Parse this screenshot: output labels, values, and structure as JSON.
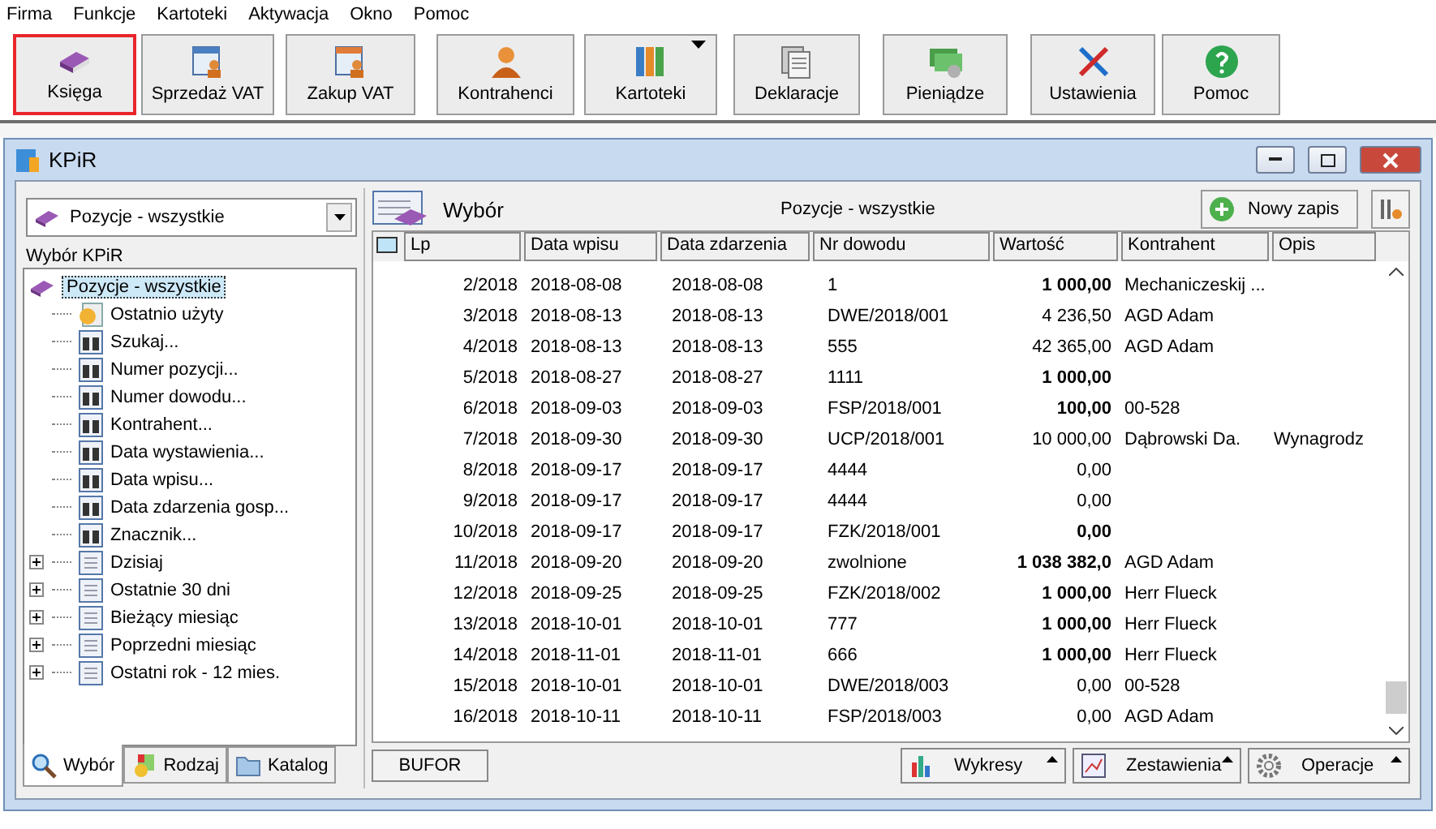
{
  "menu": [
    "Firma",
    "Funkcje",
    "Kartoteki",
    "Aktywacja",
    "Okno",
    "Pomoc"
  ],
  "toolbar": [
    {
      "label": "Księga",
      "kind": "book",
      "selected": true,
      "dropdown": false
    },
    {
      "label": "Sprzedaż VAT",
      "kind": "sale",
      "selected": false,
      "dropdown": false
    },
    {
      "label": "Zakup VAT",
      "kind": "purchase",
      "selected": false,
      "dropdown": false
    },
    {
      "label": "Kontrahenci",
      "kind": "person",
      "selected": false,
      "dropdown": false
    },
    {
      "label": "Kartoteki",
      "kind": "binders",
      "selected": false,
      "dropdown": true
    },
    {
      "label": "Deklaracje",
      "kind": "docs",
      "selected": false,
      "dropdown": false
    },
    {
      "label": "Pieniądze",
      "kind": "money",
      "selected": false,
      "dropdown": false
    },
    {
      "label": "Ustawienia",
      "kind": "tools",
      "selected": false,
      "dropdown": false
    },
    {
      "label": "Pomoc",
      "kind": "help",
      "selected": false,
      "dropdown": false
    }
  ],
  "window": {
    "title": "KPiR"
  },
  "left": {
    "combo": "Pozycje - wszystkie",
    "label": "Wybór KPiR",
    "tree": {
      "label": "Pozycje - wszystkie",
      "selected": true,
      "children": [
        {
          "label": "Ostatnio użyty",
          "kind": "recent",
          "expandable": false
        },
        {
          "label": "Szukaj...",
          "kind": "binoculars",
          "expandable": false
        },
        {
          "label": "Numer pozycji...",
          "kind": "binoculars",
          "expandable": false
        },
        {
          "label": "Numer dowodu...",
          "kind": "binoculars",
          "expandable": false
        },
        {
          "label": "Kontrahent...",
          "kind": "binoculars",
          "expandable": false
        },
        {
          "label": "Data wystawienia...",
          "kind": "binoculars",
          "expandable": false
        },
        {
          "label": "Data wpisu...",
          "kind": "binoculars",
          "expandable": false
        },
        {
          "label": "Data zdarzenia gosp...",
          "kind": "binoculars",
          "expandable": false
        },
        {
          "label": "Znacznik...",
          "kind": "binoculars",
          "expandable": false
        },
        {
          "label": "Dzisiaj",
          "kind": "list",
          "expandable": true
        },
        {
          "label": "Ostatnie 30 dni",
          "kind": "list",
          "expandable": true
        },
        {
          "label": "Bieżący miesiąc",
          "kind": "list",
          "expandable": true
        },
        {
          "label": "Poprzedni miesiąc",
          "kind": "list",
          "expandable": true
        },
        {
          "label": "Ostatni rok - 12 mies.",
          "kind": "list",
          "expandable": true
        }
      ]
    },
    "tabs": [
      {
        "label": "Wybór",
        "kind": "search",
        "selected": true
      },
      {
        "label": "Rodzaj",
        "kind": "medal",
        "selected": false
      },
      {
        "label": "Katalog",
        "kind": "folder",
        "selected": false
      }
    ]
  },
  "right": {
    "heading": "Wybór",
    "subtitle": "Pozycje - wszystkie",
    "new_button": "Nowy zapis",
    "columns": [
      "Lp",
      "Data wpisu",
      "Data zdarzenia",
      "Nr dowodu",
      "Wartość",
      "Kontrahent",
      "Opis"
    ],
    "rows": [
      {
        "cells": [
          "2/2018",
          "2018-08-08",
          "2018-08-08",
          "1",
          "1 000,00",
          "Mechaniczeskij ...",
          ""
        ],
        "bold": true
      },
      {
        "cells": [
          "3/2018",
          "2018-08-13",
          "2018-08-13",
          "DWE/2018/001",
          "4 236,50",
          "AGD Adam",
          ""
        ],
        "bold": false
      },
      {
        "cells": [
          "4/2018",
          "2018-08-13",
          "2018-08-13",
          "555",
          "42 365,00",
          "AGD Adam",
          ""
        ],
        "bold": false
      },
      {
        "cells": [
          "5/2018",
          "2018-08-27",
          "2018-08-27",
          "1111",
          "1 000,00",
          "",
          ""
        ],
        "bold": true
      },
      {
        "cells": [
          "6/2018",
          "2018-09-03",
          "2018-09-03",
          "FSP/2018/001",
          "100,00",
          "00-528",
          ""
        ],
        "bold": true
      },
      {
        "cells": [
          "7/2018",
          "2018-09-30",
          "2018-09-30",
          "UCP/2018/001",
          "10 000,00",
          "Dąbrowski Da.",
          "Wynagrodz"
        ],
        "bold": false
      },
      {
        "cells": [
          "8/2018",
          "2018-09-17",
          "2018-09-17",
          "4444",
          "0,00",
          "",
          ""
        ],
        "bold": false
      },
      {
        "cells": [
          "9/2018",
          "2018-09-17",
          "2018-09-17",
          "4444",
          "0,00",
          "",
          ""
        ],
        "bold": false
      },
      {
        "cells": [
          "10/2018",
          "2018-09-17",
          "2018-09-17",
          "FZK/2018/001",
          "0,00",
          "",
          ""
        ],
        "bold": true
      },
      {
        "cells": [
          "11/2018",
          "2018-09-20",
          "2018-09-20",
          "zwolnione",
          "1 038 382,0",
          "AGD Adam",
          ""
        ],
        "bold": true
      },
      {
        "cells": [
          "12/2018",
          "2018-09-25",
          "2018-09-25",
          "FZK/2018/002",
          "1 000,00",
          "Herr Flueck",
          ""
        ],
        "bold": true
      },
      {
        "cells": [
          "13/2018",
          "2018-10-01",
          "2018-10-01",
          "777",
          "1 000,00",
          "Herr Flueck",
          ""
        ],
        "bold": true
      },
      {
        "cells": [
          "14/2018",
          "2018-11-01",
          "2018-11-01",
          "666",
          "1 000,00",
          "Herr Flueck",
          ""
        ],
        "bold": true
      },
      {
        "cells": [
          "15/2018",
          "2018-10-01",
          "2018-10-01",
          "DWE/2018/003",
          "0,00",
          "00-528",
          ""
        ],
        "bold": false
      },
      {
        "cells": [
          "16/2018",
          "2018-10-11",
          "2018-10-11",
          "FSP/2018/003",
          "0,00",
          "AGD Adam",
          ""
        ],
        "bold": false
      }
    ],
    "buffer_button": "BUFOR",
    "bottom_buttons": [
      {
        "label": "Wykresy",
        "kind": "chart"
      },
      {
        "label": "Zestawienia",
        "kind": "report"
      },
      {
        "label": "Operacje",
        "kind": "gear"
      }
    ]
  }
}
